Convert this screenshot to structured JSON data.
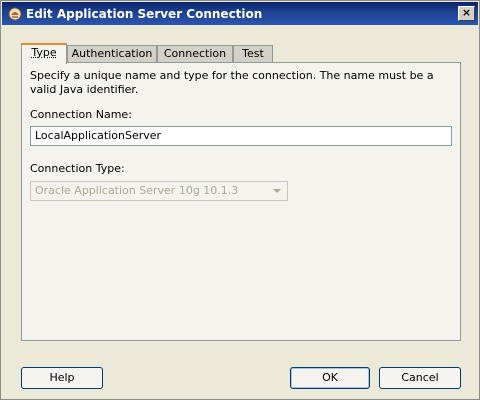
{
  "window": {
    "title": "Edit Application Server Connection"
  },
  "tabs": [
    {
      "label": "Type",
      "active": true
    },
    {
      "label": "Authentication",
      "active": false
    },
    {
      "label": "Connection",
      "active": false
    },
    {
      "label": "Test",
      "active": false
    }
  ],
  "type_panel": {
    "description": "Specify a unique name and type for the connection. The name must be a valid Java identifier.",
    "connection_name_label": "Connection Name:",
    "connection_name_value": "LocalApplicationServer",
    "connection_type_label": "Connection Type:",
    "connection_type_value": "Oracle Application Server 10g 10.1.3"
  },
  "buttons": {
    "help": "Help",
    "ok": "OK",
    "cancel": "Cancel"
  },
  "colors": {
    "titlebar": "#0a246a",
    "active_tab_accent": "#e68b2c"
  }
}
